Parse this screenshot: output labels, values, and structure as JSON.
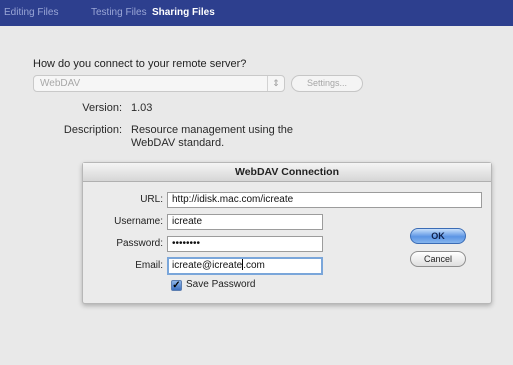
{
  "tabs": [
    {
      "label": "Editing Files",
      "active": false
    },
    {
      "label": "Testing Files",
      "active": false
    },
    {
      "label": "Sharing Files",
      "active": true
    }
  ],
  "colors": {
    "tabbar": "#2d3f8e",
    "accent": "#5c95e4"
  },
  "server": {
    "question": "How do you connect to your remote server?",
    "selected": "WebDAV",
    "settings_label": "Settings..."
  },
  "info": {
    "version_label": "Version:",
    "version_value": "1.03",
    "description_label": "Description:",
    "description_line1": "Resource management using the",
    "description_line2": "WebDAV standard."
  },
  "dialog": {
    "title": "WebDAV Connection",
    "url_label": "URL:",
    "url_value": "http://idisk.mac.com/icreate",
    "username_label": "Username:",
    "username_value": "icreate",
    "password_label": "Password:",
    "password_value": "••••••••",
    "email_label": "Email:",
    "email_value_before": "icreate@icreate",
    "email_value_after": ".com",
    "save_password_label": "Save Password",
    "save_password_checked": true,
    "ok_label": "OK",
    "cancel_label": "Cancel"
  }
}
